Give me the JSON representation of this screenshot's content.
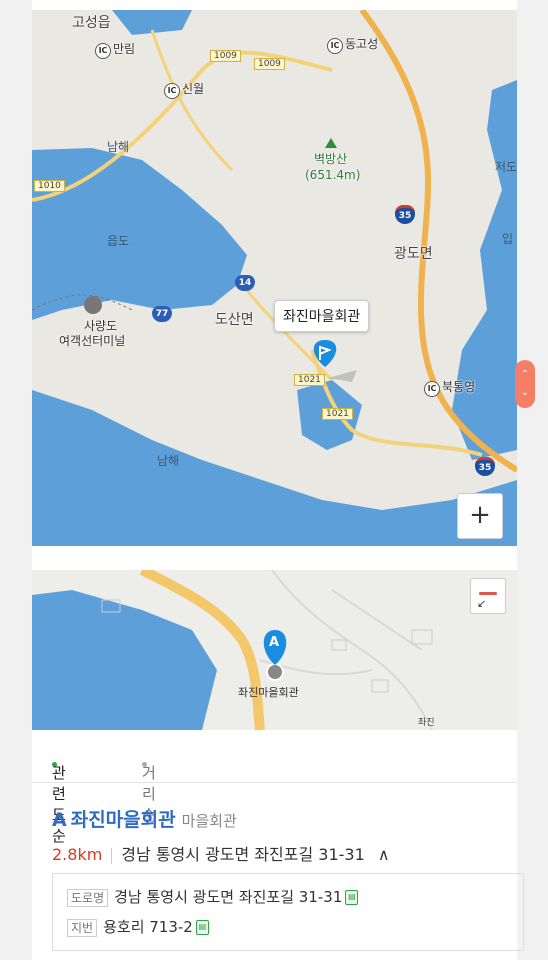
{
  "map_overview": {
    "places": {
      "goseong": "고성읍",
      "manrim": "만림",
      "sinwol": "신월",
      "donggoseong": "동고성",
      "namhae1": "남해",
      "namhae2": "남해",
      "eupdo": "읍도",
      "mountain": "벽방산",
      "mountain_height": "(651.4m)",
      "jeodo": "저도",
      "ip": "입",
      "gwangdo": "광도면",
      "dosan": "도산면",
      "saryangdo_1": "사량도",
      "saryangdo_2": "여객선터미널",
      "buktongyeong": "북통영"
    },
    "road_numbers": {
      "r1009a": "1009",
      "r1009b": "1009",
      "r1010": "1010",
      "r1021a": "1021",
      "r1021b": "1021",
      "s14": "14",
      "s77": "77",
      "s35a": "35",
      "s35b": "35"
    },
    "ic_label": "IC",
    "callout_name": "좌진마을회관",
    "zoom_in_label": "+",
    "scroll_up": "⌃",
    "scroll_down": "⌄"
  },
  "map_detail": {
    "pin_letter": "A",
    "pin_label": "좌진마을회관",
    "side_text": "좌진"
  },
  "sort_options": [
    {
      "label": "관련도순",
      "active": true
    },
    {
      "label": "거리순",
      "active": false
    }
  ],
  "result": {
    "letter": "A",
    "name": "좌진마을회관",
    "category": "마을회관",
    "distance": "2.8km",
    "address": "경남 통영시 광도면 좌진포길 31-31",
    "expand": "∧",
    "road_tag": "도로명",
    "road_address": "경남 통영시 광도면 좌진포길 31-31",
    "lot_tag": "지번",
    "lot_address": "용호리 713-2"
  },
  "colors": {
    "sea": "#5d9fd8",
    "land": "#e9e8e2",
    "road": "#f4c86a",
    "accent": "#2e6cc2",
    "distance": "#d63b2a",
    "pin": "#1a8de0"
  }
}
